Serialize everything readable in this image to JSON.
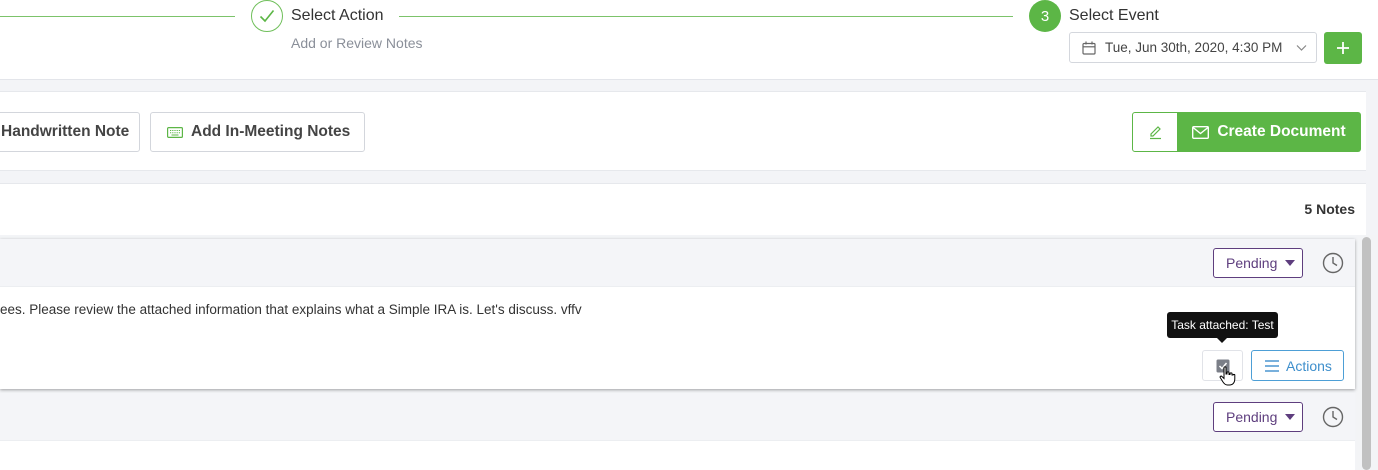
{
  "stepper": {
    "step2": {
      "title": "Select Action",
      "subtitle": "Add or Review Notes",
      "icon": "check-icon"
    },
    "step3": {
      "number": "3",
      "title": "Select Event"
    },
    "event_select": {
      "value": "Tue, Jun 30th, 2020, 4:30 PM",
      "icon": "calendar-icon"
    },
    "add_button_icon": "plus-icon",
    "accent_color": "#5cb646"
  },
  "toolbar": {
    "handwritten_label": "Handwritten Note",
    "in_meeting_label": "Add In-Meeting Notes",
    "create_document_label": "Create Document"
  },
  "notes": {
    "count_label": "5 Notes",
    "items": [
      {
        "status": "Pending",
        "text": "ees. Please review the attached information that explains what a Simple IRA is. Let's discuss. vffv",
        "task_tooltip": "Task attached: Test",
        "actions_label": "Actions"
      },
      {
        "status": "Pending"
      }
    ]
  },
  "colors": {
    "pending": "#5e3e7e",
    "actions": "#3e8fcc"
  }
}
